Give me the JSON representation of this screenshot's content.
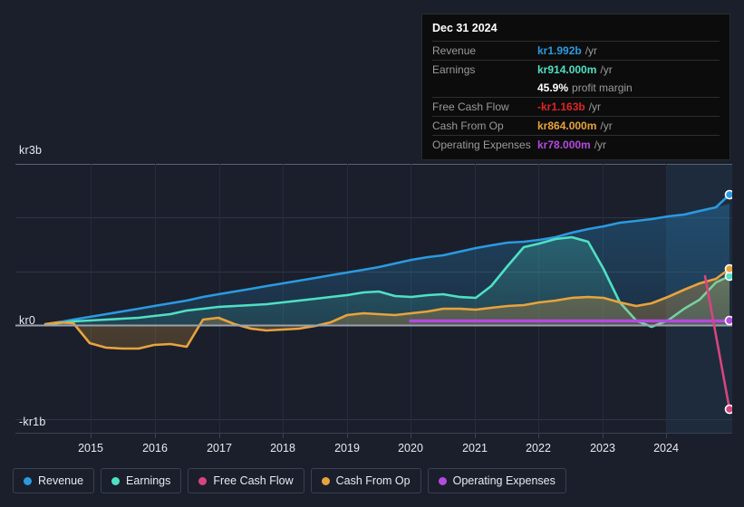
{
  "tooltip": {
    "date": "Dec 31 2024",
    "rows": [
      {
        "label": "Revenue",
        "value": "kr1.992b",
        "unit": "/yr",
        "color": "#2b9ae0"
      },
      {
        "label": "Earnings",
        "value": "kr914.000m",
        "unit": "/yr",
        "color": "#4fe0c4"
      },
      {
        "label": "",
        "value": "45.9%",
        "unit": "profit margin",
        "color": "#ffffff"
      },
      {
        "label": "Free Cash Flow",
        "value": "-kr1.163b",
        "unit": "/yr",
        "color": "#e02424"
      },
      {
        "label": "Cash From Op",
        "value": "kr864.000m",
        "unit": "/yr",
        "color": "#e8a33d"
      },
      {
        "label": "Operating Expenses",
        "value": "kr78.000m",
        "unit": "/yr",
        "color": "#b44ae0"
      }
    ]
  },
  "legend": {
    "items": [
      {
        "label": "Revenue",
        "color": "#2b9ae0"
      },
      {
        "label": "Earnings",
        "color": "#4fe0c4"
      },
      {
        "label": "Free Cash Flow",
        "color": "#d6457f"
      },
      {
        "label": "Cash From Op",
        "color": "#e8a33d"
      },
      {
        "label": "Operating Expenses",
        "color": "#b44ae0"
      }
    ]
  },
  "axes": {
    "y_labels": [
      "kr3b",
      "kr0",
      "-kr1b"
    ],
    "x_labels": [
      "2015",
      "2016",
      "2017",
      "2018",
      "2019",
      "2020",
      "2021",
      "2022",
      "2023",
      "2024"
    ]
  },
  "chart_data": {
    "type": "area",
    "title": "",
    "xlabel": "",
    "ylabel": "",
    "currency": "kr",
    "ylim": [
      -1000000000,
      3000000000
    ],
    "y_ticks": [
      3000000000,
      0,
      -1000000000
    ],
    "y_tick_labels": [
      "kr3b",
      "kr0",
      "-kr1b"
    ],
    "grid": true,
    "legend_position": "bottom",
    "x_ticks": [
      2015,
      2016,
      2017,
      2018,
      2019,
      2020,
      2021,
      2022,
      2023,
      2024
    ],
    "forecast_start": 2024,
    "x": [
      2014.5,
      2014.75,
      2015.0,
      2015.25,
      2015.5,
      2015.75,
      2016.0,
      2016.25,
      2016.5,
      2016.75,
      2017.0,
      2017.25,
      2017.5,
      2017.75,
      2018.0,
      2018.25,
      2018.5,
      2018.75,
      2019.0,
      2019.25,
      2019.5,
      2019.75,
      2020.0,
      2020.25,
      2020.5,
      2020.75,
      2021.0,
      2021.25,
      2021.5,
      2021.75,
      2022.0,
      2022.25,
      2022.5,
      2022.75,
      2023.0,
      2023.25,
      2023.5,
      2023.75,
      2024.0,
      2024.25,
      2024.5,
      2024.75,
      2025.0
    ],
    "series": [
      {
        "name": "Revenue",
        "color": "#2b9ae0",
        "unit": "kr",
        "values": [
          0.02,
          0.05,
          0.1,
          0.14,
          0.18,
          0.22,
          0.26,
          0.3,
          0.34,
          0.38,
          0.44,
          0.48,
          0.52,
          0.56,
          0.6,
          0.64,
          0.68,
          0.72,
          0.76,
          0.8,
          0.84,
          0.88,
          0.94,
          1.0,
          1.05,
          1.08,
          1.14,
          1.2,
          1.26,
          1.3,
          1.33,
          1.36,
          1.42,
          1.5,
          1.56,
          1.62,
          1.68,
          1.72,
          1.76,
          1.8,
          1.84,
          1.9,
          1.992
        ]
      },
      {
        "name": "Earnings",
        "color": "#4fe0c4",
        "unit": "kr",
        "values": [
          0.01,
          0.03,
          0.06,
          0.08,
          0.1,
          0.12,
          0.14,
          0.16,
          0.2,
          0.26,
          0.3,
          0.33,
          0.36,
          0.38,
          0.4,
          0.42,
          0.45,
          0.48,
          0.52,
          0.56,
          0.6,
          0.62,
          0.54,
          0.52,
          0.56,
          0.58,
          0.52,
          0.5,
          0.72,
          1.1,
          1.45,
          1.52,
          1.6,
          1.63,
          1.55,
          1.05,
          0.42,
          0.08,
          -0.04,
          0.08,
          0.3,
          0.48,
          0.914
        ]
      },
      {
        "name": "Free Cash Flow",
        "color": "#d6457f",
        "unit": "kr",
        "values": [
          null,
          null,
          null,
          null,
          null,
          null,
          null,
          null,
          null,
          null,
          null,
          null,
          null,
          null,
          null,
          null,
          null,
          null,
          null,
          null,
          null,
          null,
          null,
          null,
          null,
          null,
          null,
          null,
          null,
          null,
          null,
          null,
          null,
          null,
          null,
          null,
          null,
          null,
          null,
          null,
          null,
          0.82,
          -1.163
        ]
      },
      {
        "name": "Cash From Op",
        "color": "#e8a33d",
        "unit": "kr",
        "values": [
          0.02,
          0.05,
          0.04,
          -0.34,
          -0.42,
          -0.44,
          -0.44,
          -0.38,
          -0.36,
          -0.4,
          0.1,
          0.14,
          0.02,
          -0.06,
          -0.1,
          -0.08,
          -0.06,
          -0.02,
          0.06,
          0.18,
          0.22,
          0.2,
          0.18,
          0.22,
          0.24,
          0.3,
          0.3,
          0.28,
          0.32,
          0.36,
          0.38,
          0.42,
          0.46,
          0.5,
          0.52,
          0.5,
          0.42,
          0.36,
          0.4,
          0.52,
          0.66,
          0.78,
          0.864
        ]
      },
      {
        "name": "Operating Expenses",
        "color": "#b44ae0",
        "unit": "kr",
        "values": [
          null,
          null,
          null,
          null,
          null,
          null,
          null,
          null,
          null,
          null,
          null,
          null,
          null,
          null,
          null,
          null,
          null,
          null,
          null,
          null,
          null,
          null,
          0.078,
          0.078,
          0.078,
          0.078,
          0.078,
          0.078,
          0.078,
          0.078,
          0.078,
          0.078,
          0.078,
          0.078,
          0.078,
          0.078,
          0.078,
          0.078,
          0.078,
          0.078,
          0.078,
          0.078,
          0.078
        ]
      }
    ]
  }
}
